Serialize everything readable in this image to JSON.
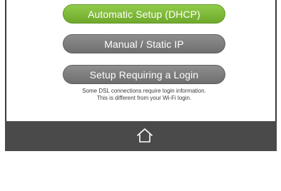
{
  "setup_options": {
    "automatic_label": "Automatic Setup (DHCP)",
    "manual_label": "Manual / Static IP",
    "login_label": "Setup Requiring a Login"
  },
  "login_note": {
    "line1": "Some DSL connections require login information.",
    "line2": "This is different from your Wi-Fi login."
  },
  "bottom_bar": {
    "home_icon": "home-icon"
  },
  "colors": {
    "accent_green": "#7cb83a",
    "button_gray": "#7d7d7d",
    "bottom_bar": "#4a4a4a"
  }
}
